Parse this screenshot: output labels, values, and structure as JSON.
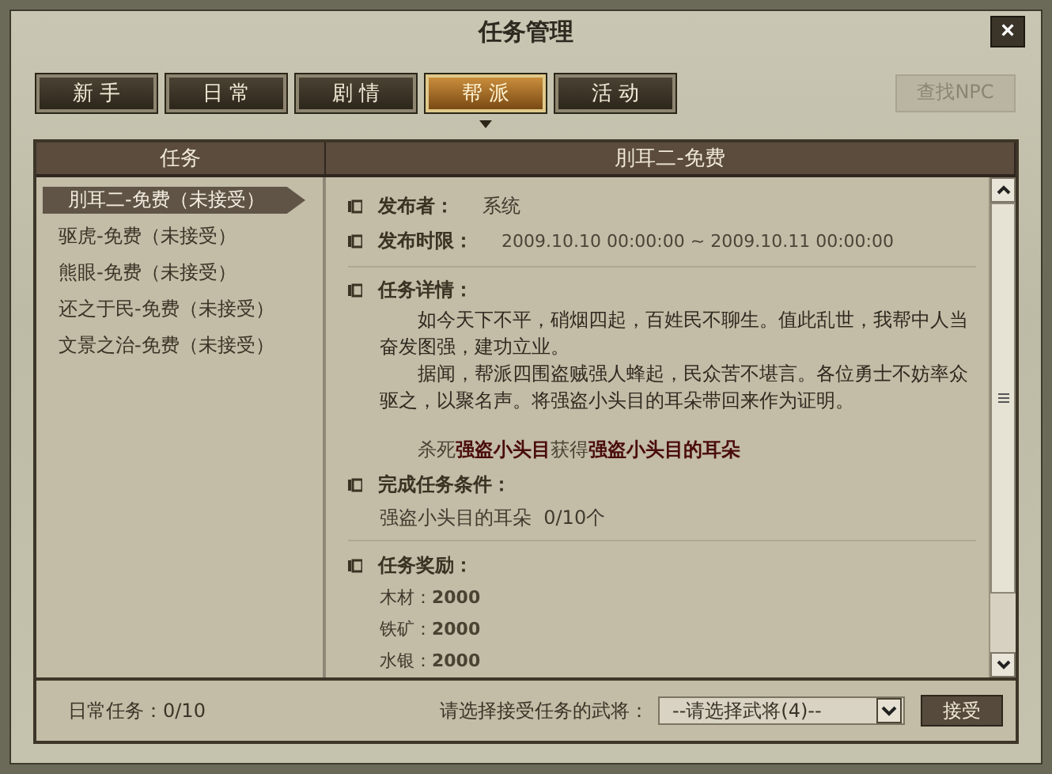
{
  "window": {
    "title": "任务管理",
    "close": "×"
  },
  "tabs": [
    {
      "label": "新 手",
      "selected": false
    },
    {
      "label": "日 常",
      "selected": false
    },
    {
      "label": "剧 情",
      "selected": false
    },
    {
      "label": "帮 派",
      "selected": true
    },
    {
      "label": "活 动",
      "selected": false
    }
  ],
  "find_npc": {
    "label": "查找NPC",
    "disabled": true
  },
  "task_list": {
    "header": "任务",
    "items": [
      {
        "label": "刖耳二-免费（未接受）",
        "selected": true
      },
      {
        "label": "驱虎-免费（未接受）",
        "selected": false
      },
      {
        "label": "熊眼-免费（未接受）",
        "selected": false
      },
      {
        "label": "还之于民-免费（未接受）",
        "selected": false
      },
      {
        "label": "文景之治-免费（未接受）",
        "selected": false
      }
    ]
  },
  "detail": {
    "header": "刖耳二-免费",
    "publisher": {
      "label": "发布者：",
      "value": "系统"
    },
    "period": {
      "label": "发布时限：",
      "value": "2009.10.10 00:00:00 ~ 2009.10.11 00:00:00"
    },
    "description": {
      "label": "任务详情：",
      "paragraphs": [
        "如今天下不平，硝烟四起，百姓民不聊生。值此乱世，我帮中人当奋发图强，建功立业。",
        "据闻，帮派四围盗贼强人蜂起，民众苦不堪言。各位勇士不妨率众驱之，以聚名声。将强盗小头目的耳朵带回来作为证明。"
      ],
      "objective": "杀死**强盗小头目**获得**强盗小头目的耳朵**"
    },
    "conditions": {
      "label": "完成任务条件：",
      "items": [
        "强盗小头目的耳朵  0/10个"
      ]
    },
    "rewards": {
      "label": "任务奖励：",
      "items": [
        {
          "name": "木材：",
          "value": "2000"
        },
        {
          "name": "铁矿：",
          "value": "2000"
        },
        {
          "name": "水银：",
          "value": "2000"
        }
      ]
    }
  },
  "footer": {
    "daily": "日常任务：0/10",
    "general_label": "请选择接受任务的武将：",
    "general_select": "--请选择武将(4)--",
    "accept": "接受"
  }
}
